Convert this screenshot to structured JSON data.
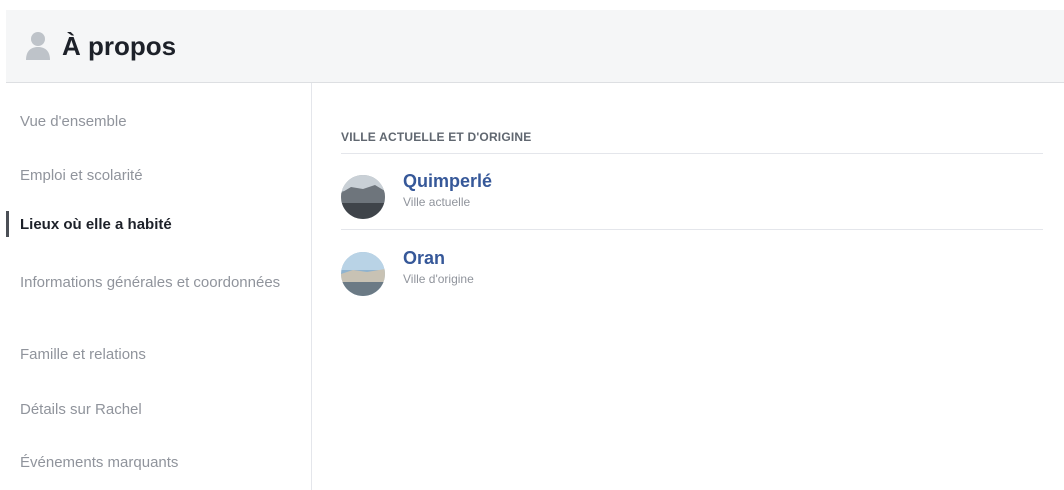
{
  "header": {
    "title": "À propos",
    "icon": "person-silhouette-icon"
  },
  "sidebar": {
    "items": [
      {
        "label": "Vue d'ensemble"
      },
      {
        "label": "Emploi et scolarité"
      },
      {
        "label": "Lieux où elle a habité",
        "active": true
      },
      {
        "label": "Informations générales et coordonnées"
      },
      {
        "label": "Famille et relations"
      },
      {
        "label": "Détails sur Rachel"
      },
      {
        "label": "Événements marquants"
      }
    ]
  },
  "main": {
    "section_title": "VILLE ACTUELLE ET D'ORIGINE",
    "places": [
      {
        "name": "Quimperlé",
        "subtitle": "Ville actuelle",
        "icon": "city-photo-thumbnail"
      },
      {
        "name": "Oran",
        "subtitle": "Ville d'origine",
        "icon": "city-photo-thumbnail"
      }
    ]
  },
  "colors": {
    "link": "#365899",
    "muted": "#90949c",
    "header_bg": "#f5f6f7"
  }
}
